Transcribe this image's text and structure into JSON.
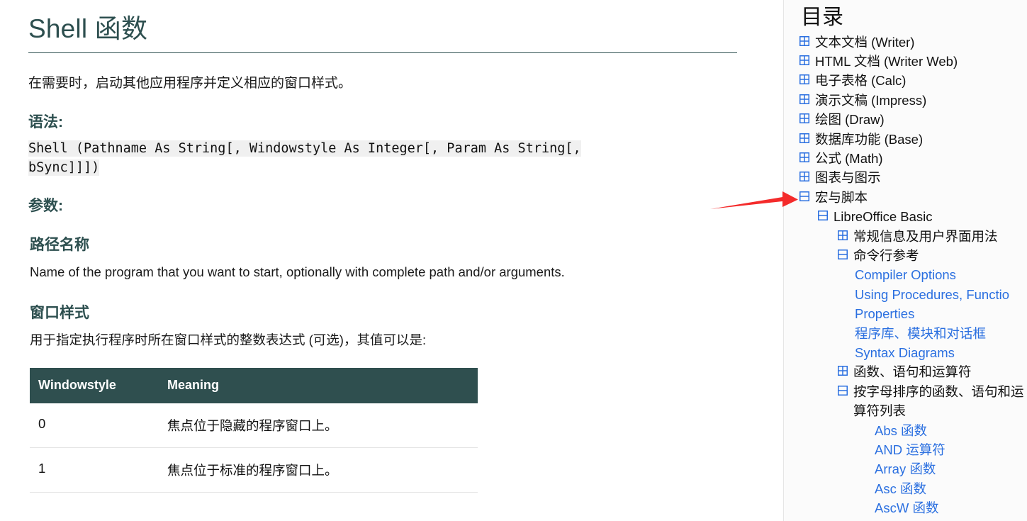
{
  "document": {
    "title": "Shell 函数",
    "intro": "在需要时，启动其他应用程序并定义相应的窗口样式。",
    "syntax_heading": "语法:",
    "syntax_code_line1": "Shell (Pathname As String[, Windowstyle As Integer[, Param As String[,",
    "syntax_code_line2": "bSync]]])",
    "parameters_heading": "参数:",
    "param1_heading": "路径名称",
    "param1_text": "Name of the program that you want to start, optionally with complete path and/or arguments.",
    "param2_heading": "窗口样式",
    "param2_text": "用于指定执行程序时所在窗口样式的整数表达式 (可选)，其值可以是:"
  },
  "table": {
    "headers": [
      "Windowstyle",
      "Meaning"
    ],
    "rows": [
      {
        "value": "0",
        "meaning": "焦点位于隐藏的程序窗口上。"
      },
      {
        "value": "1",
        "meaning": "焦点位于标准的程序窗口上。"
      }
    ]
  },
  "sidebar": {
    "title": "目录",
    "items": [
      {
        "level": 1,
        "icon": "expand-plus-icon",
        "label": "文本文档 (Writer)",
        "type": "node"
      },
      {
        "level": 1,
        "icon": "expand-plus-icon",
        "label": "HTML 文档 (Writer Web)",
        "type": "node"
      },
      {
        "level": 1,
        "icon": "expand-plus-icon",
        "label": "电子表格 (Calc)",
        "type": "node"
      },
      {
        "level": 1,
        "icon": "expand-plus-icon",
        "label": "演示文稿 (Impress)",
        "type": "node"
      },
      {
        "level": 1,
        "icon": "expand-plus-icon",
        "label": "绘图 (Draw)",
        "type": "node"
      },
      {
        "level": 1,
        "icon": "expand-plus-icon",
        "label": "数据库功能 (Base)",
        "type": "node"
      },
      {
        "level": 1,
        "icon": "expand-plus-icon",
        "label": "公式 (Math)",
        "type": "node"
      },
      {
        "level": 1,
        "icon": "expand-plus-icon",
        "label": "图表与图示",
        "type": "node"
      },
      {
        "level": 1,
        "icon": "collapse-minus-icon",
        "label": "宏与脚本",
        "type": "node"
      },
      {
        "level": 2,
        "icon": "collapse-minus-icon",
        "label": "LibreOffice Basic",
        "type": "node"
      },
      {
        "level": 3,
        "icon": "expand-plus-icon",
        "label": "常规信息及用户界面用法",
        "type": "node"
      },
      {
        "level": 3,
        "icon": "collapse-minus-icon",
        "label": "命令行参考",
        "type": "node"
      },
      {
        "level": 4,
        "icon": "none",
        "label": "Compiler Options",
        "type": "link"
      },
      {
        "level": 4,
        "icon": "none",
        "label": "Using Procedures, Functio",
        "type": "link"
      },
      {
        "level": 4,
        "icon": "none",
        "label": "Properties",
        "type": "link"
      },
      {
        "level": 4,
        "icon": "none",
        "label": "程序库、模块和对话框",
        "type": "link"
      },
      {
        "level": 4,
        "icon": "none",
        "label": "Syntax Diagrams",
        "type": "link"
      },
      {
        "level": 3,
        "icon": "expand-plus-icon",
        "label": "函数、语句和运算符",
        "type": "node"
      },
      {
        "level": 3,
        "icon": "collapse-minus-icon",
        "label": "按字母排序的函数、语句和运算符列表",
        "type": "node-wrap"
      },
      {
        "level": 5,
        "icon": "none",
        "label": "Abs 函数",
        "type": "link"
      },
      {
        "level": 5,
        "icon": "none",
        "label": "AND 运算符",
        "type": "link"
      },
      {
        "level": 5,
        "icon": "none",
        "label": "Array 函数",
        "type": "link"
      },
      {
        "level": 5,
        "icon": "none",
        "label": "Asc 函数",
        "type": "link"
      },
      {
        "level": 5,
        "icon": "none",
        "label": "AscW 函数",
        "type": "link"
      }
    ]
  },
  "annotation": {
    "arrow": "red-arrow-icon",
    "points_to": "宏与脚本",
    "color": "#f42b2b"
  },
  "colors": {
    "heading": "#2d4f4f",
    "table_header_bg": "#2f4f4f",
    "link": "#2a6fe0",
    "icon": "#2a6fe0",
    "code_bg": "#f0f0f0",
    "sidebar_bg": "#fbfbfb",
    "arrow": "#f42b2b"
  }
}
